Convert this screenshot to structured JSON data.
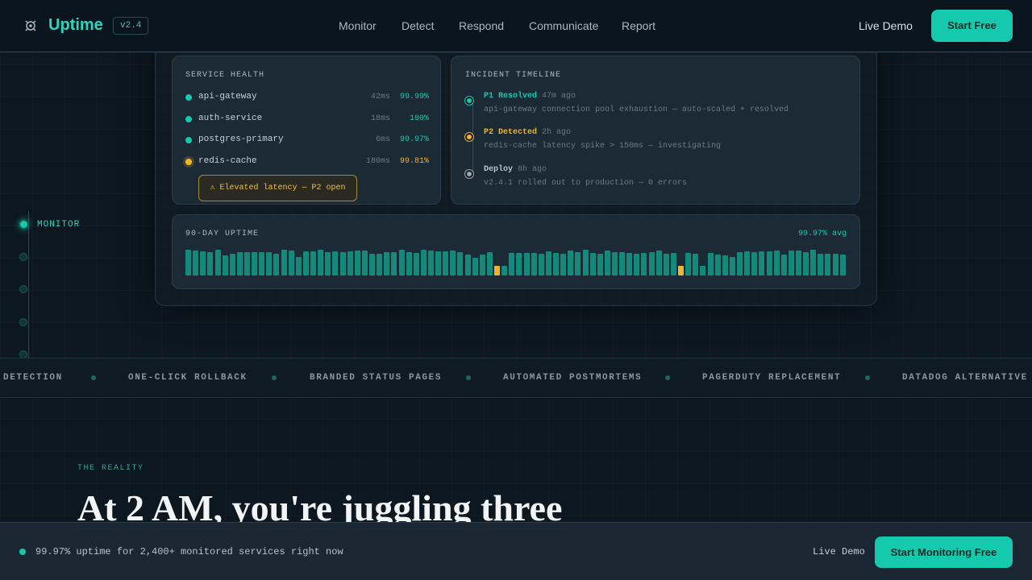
{
  "nav": {
    "brand": "Uptime",
    "version": "v2.4",
    "links": [
      "Monitor",
      "Detect",
      "Respond",
      "Communicate",
      "Report"
    ],
    "live_demo": "Live Demo",
    "start_free": "Start Free"
  },
  "service_health": {
    "title": "SERVICE HEALTH",
    "services": [
      {
        "name": "api-gateway",
        "latency": "42ms",
        "uptime": "99.99%",
        "status": "ok"
      },
      {
        "name": "auth-service",
        "latency": "18ms",
        "uptime": "100%",
        "status": "ok"
      },
      {
        "name": "postgres-primary",
        "latency": "6ms",
        "uptime": "99.97%",
        "status": "ok"
      },
      {
        "name": "redis-cache",
        "latency": "180ms",
        "uptime": "99.81%",
        "status": "warn"
      }
    ],
    "tooltip": "⚠ Elevated latency — P2 open"
  },
  "incident_timeline": {
    "title": "INCIDENT TIMELINE",
    "events": [
      {
        "label": "P1 Resolved",
        "time": "47m ago",
        "desc": "api-gateway connection pool exhaustion — auto-scaled + resolved",
        "status": "resolved"
      },
      {
        "label": "P2 Detected",
        "time": "2h ago",
        "desc": "redis-cache latency spike > 150ms — investigating",
        "status": "detected"
      },
      {
        "label": "Deploy",
        "time": "8h ago",
        "desc": "v2.4.1 rolled out to production — 0 errors",
        "status": "deploy"
      }
    ]
  },
  "uptime_90": {
    "title": "90-DAY UPTIME",
    "avg": "99.97% avg",
    "warn_days": [
      42,
      67
    ]
  },
  "side_progress": {
    "active_label": "MONITOR"
  },
  "ticker": {
    "items": [
      "DETECTION",
      "ONE-CLICK ROLLBACK",
      "BRANDED STATUS PAGES",
      "AUTOMATED POSTMORTEMS",
      "PAGERDUTY REPLACEMENT",
      "DATADOG ALTERNATIVE"
    ]
  },
  "reality": {
    "eyebrow": "THE REALITY",
    "headline": "At 2 AM, you're juggling three"
  },
  "bottom_bar": {
    "status_text": "99.97% uptime for 2,400+ monitored services right now",
    "live_demo": "Live Demo",
    "cta": "Start Monitoring Free"
  },
  "colors": {
    "accent": "#14c9ae",
    "warn": "#f0b429",
    "deploy": "#9aa7b1"
  }
}
